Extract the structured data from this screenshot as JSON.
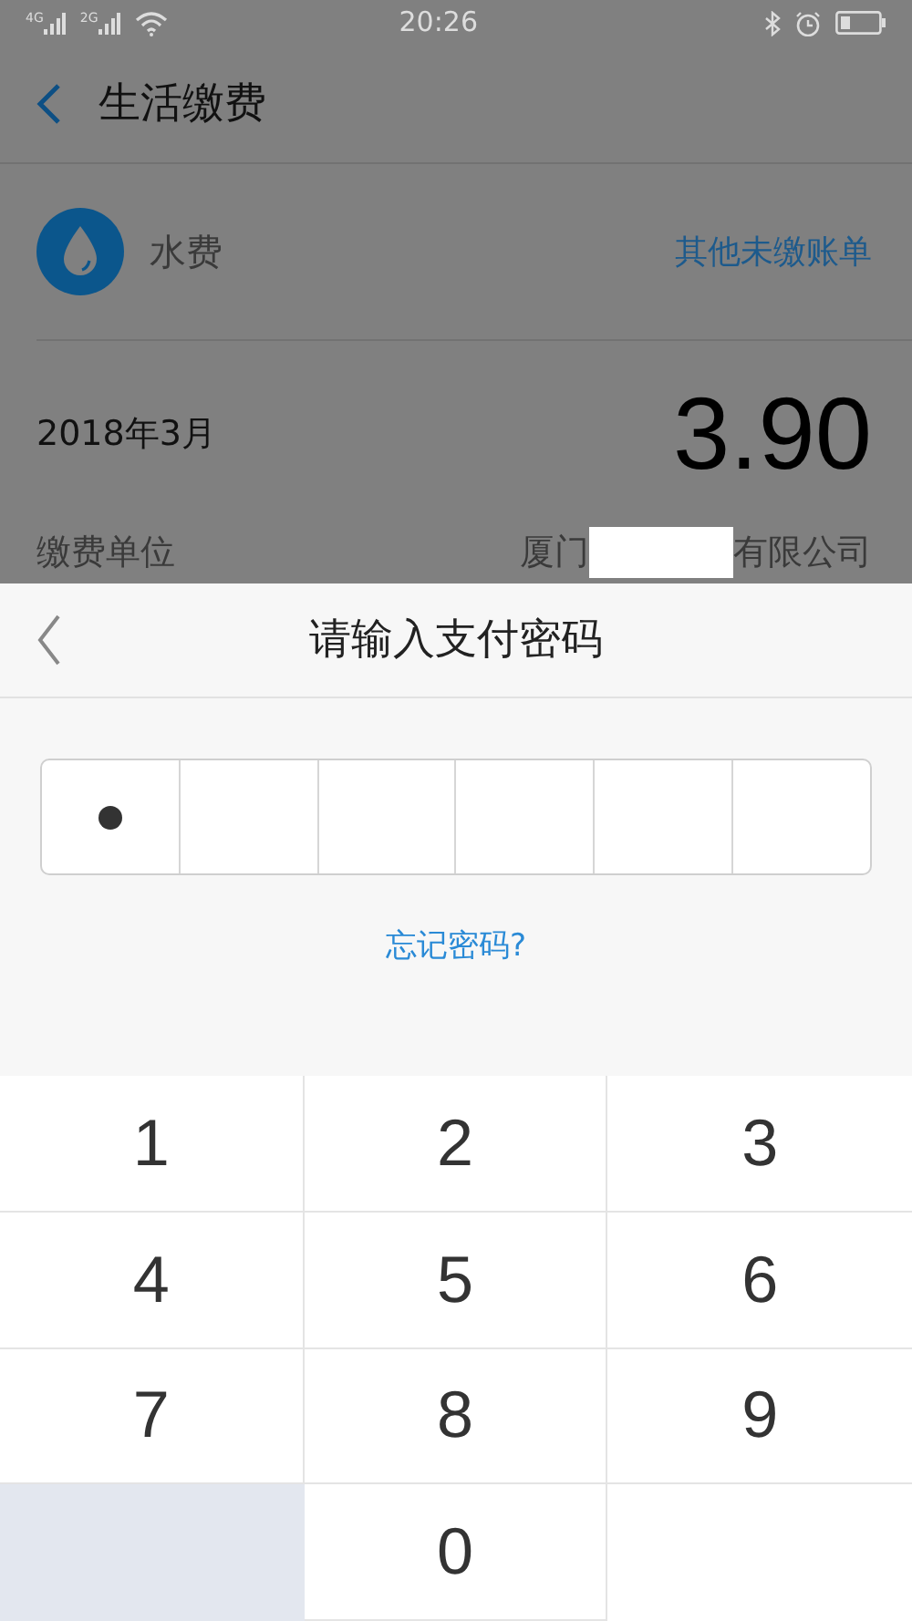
{
  "status_bar": {
    "time": "20:26",
    "signals": [
      "4G",
      "2G"
    ]
  },
  "header": {
    "title": "生活缴费"
  },
  "bill": {
    "name": "水费",
    "other_link": "其他未缴账单",
    "period": "2018年3月",
    "amount": "3.90",
    "unit_label": "缴费单位",
    "unit_prefix": "厦门",
    "unit_suffix": "有限公司"
  },
  "sheet": {
    "title": "请输入支付密码",
    "forgot_link": "忘记密码?",
    "pin": [
      {
        "filled": true
      },
      {
        "filled": false
      },
      {
        "filled": false
      },
      {
        "filled": false
      },
      {
        "filled": false
      },
      {
        "filled": false
      }
    ]
  },
  "keypad": [
    {
      "kind": "digit",
      "label": "1"
    },
    {
      "kind": "digit",
      "label": "2"
    },
    {
      "kind": "digit",
      "label": "3"
    },
    {
      "kind": "digit",
      "label": "4"
    },
    {
      "kind": "digit",
      "label": "5"
    },
    {
      "kind": "digit",
      "label": "6"
    },
    {
      "kind": "digit",
      "label": "7"
    },
    {
      "kind": "digit",
      "label": "8"
    },
    {
      "kind": "digit",
      "label": "9"
    },
    {
      "kind": "blank"
    },
    {
      "kind": "digit",
      "label": "0"
    },
    {
      "kind": "empty"
    }
  ]
}
